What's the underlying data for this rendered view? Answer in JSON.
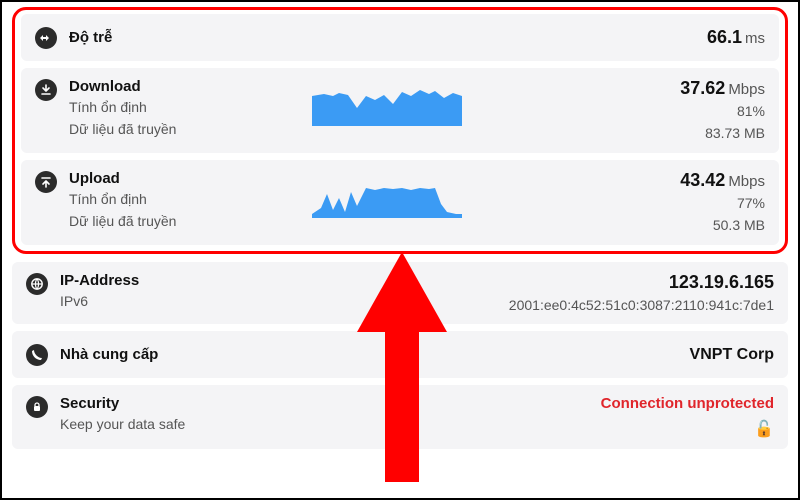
{
  "latency": {
    "label": "Độ trễ",
    "value": "66.1",
    "unit": "ms"
  },
  "download": {
    "label": "Download",
    "stability_label": "Tính ổn định",
    "data_label": "Dữ liệu đã truyền",
    "speed": "37.62",
    "unit": "Mbps",
    "stability": "81%",
    "data": "83.73 MB"
  },
  "upload": {
    "label": "Upload",
    "stability_label": "Tính ổn định",
    "data_label": "Dữ liệu đã truyền",
    "speed": "43.42",
    "unit": "Mbps",
    "stability": "77%",
    "data": "50.3 MB"
  },
  "ip": {
    "label": "IP-Address",
    "ipv6_label": "IPv6",
    "ipv4": "123.19.6.165",
    "ipv6": "2001:ee0:4c52:51c0:3087:2110:941c:7de1"
  },
  "provider": {
    "label": "Nhà cung cấp",
    "value": "VNPT Corp"
  },
  "security": {
    "label": "Security",
    "sub": "Keep your data safe",
    "status": "Connection unprotected"
  },
  "chart_data": [
    {
      "type": "area",
      "title": "Download throughput over time",
      "x_range": [
        0,
        100
      ],
      "y_range": [
        0,
        40
      ],
      "points": [
        [
          0,
          30
        ],
        [
          8,
          32
        ],
        [
          14,
          30
        ],
        [
          18,
          33
        ],
        [
          24,
          31
        ],
        [
          30,
          18
        ],
        [
          36,
          30
        ],
        [
          42,
          26
        ],
        [
          48,
          31
        ],
        [
          54,
          22
        ],
        [
          60,
          34
        ],
        [
          66,
          30
        ],
        [
          72,
          36
        ],
        [
          78,
          32
        ],
        [
          82,
          35
        ],
        [
          88,
          28
        ],
        [
          94,
          33
        ],
        [
          100,
          30
        ]
      ]
    },
    {
      "type": "area",
      "title": "Upload throughput over time",
      "x_range": [
        0,
        100
      ],
      "y_range": [
        0,
        40
      ],
      "points": [
        [
          0,
          4
        ],
        [
          6,
          10
        ],
        [
          10,
          24
        ],
        [
          14,
          8
        ],
        [
          18,
          20
        ],
        [
          22,
          6
        ],
        [
          26,
          26
        ],
        [
          30,
          12
        ],
        [
          36,
          30
        ],
        [
          42,
          28
        ],
        [
          48,
          30
        ],
        [
          54,
          29
        ],
        [
          60,
          30
        ],
        [
          66,
          28
        ],
        [
          72,
          30
        ],
        [
          78,
          29
        ],
        [
          82,
          30
        ],
        [
          86,
          14
        ],
        [
          90,
          6
        ],
        [
          96,
          4
        ],
        [
          100,
          4
        ]
      ]
    }
  ]
}
